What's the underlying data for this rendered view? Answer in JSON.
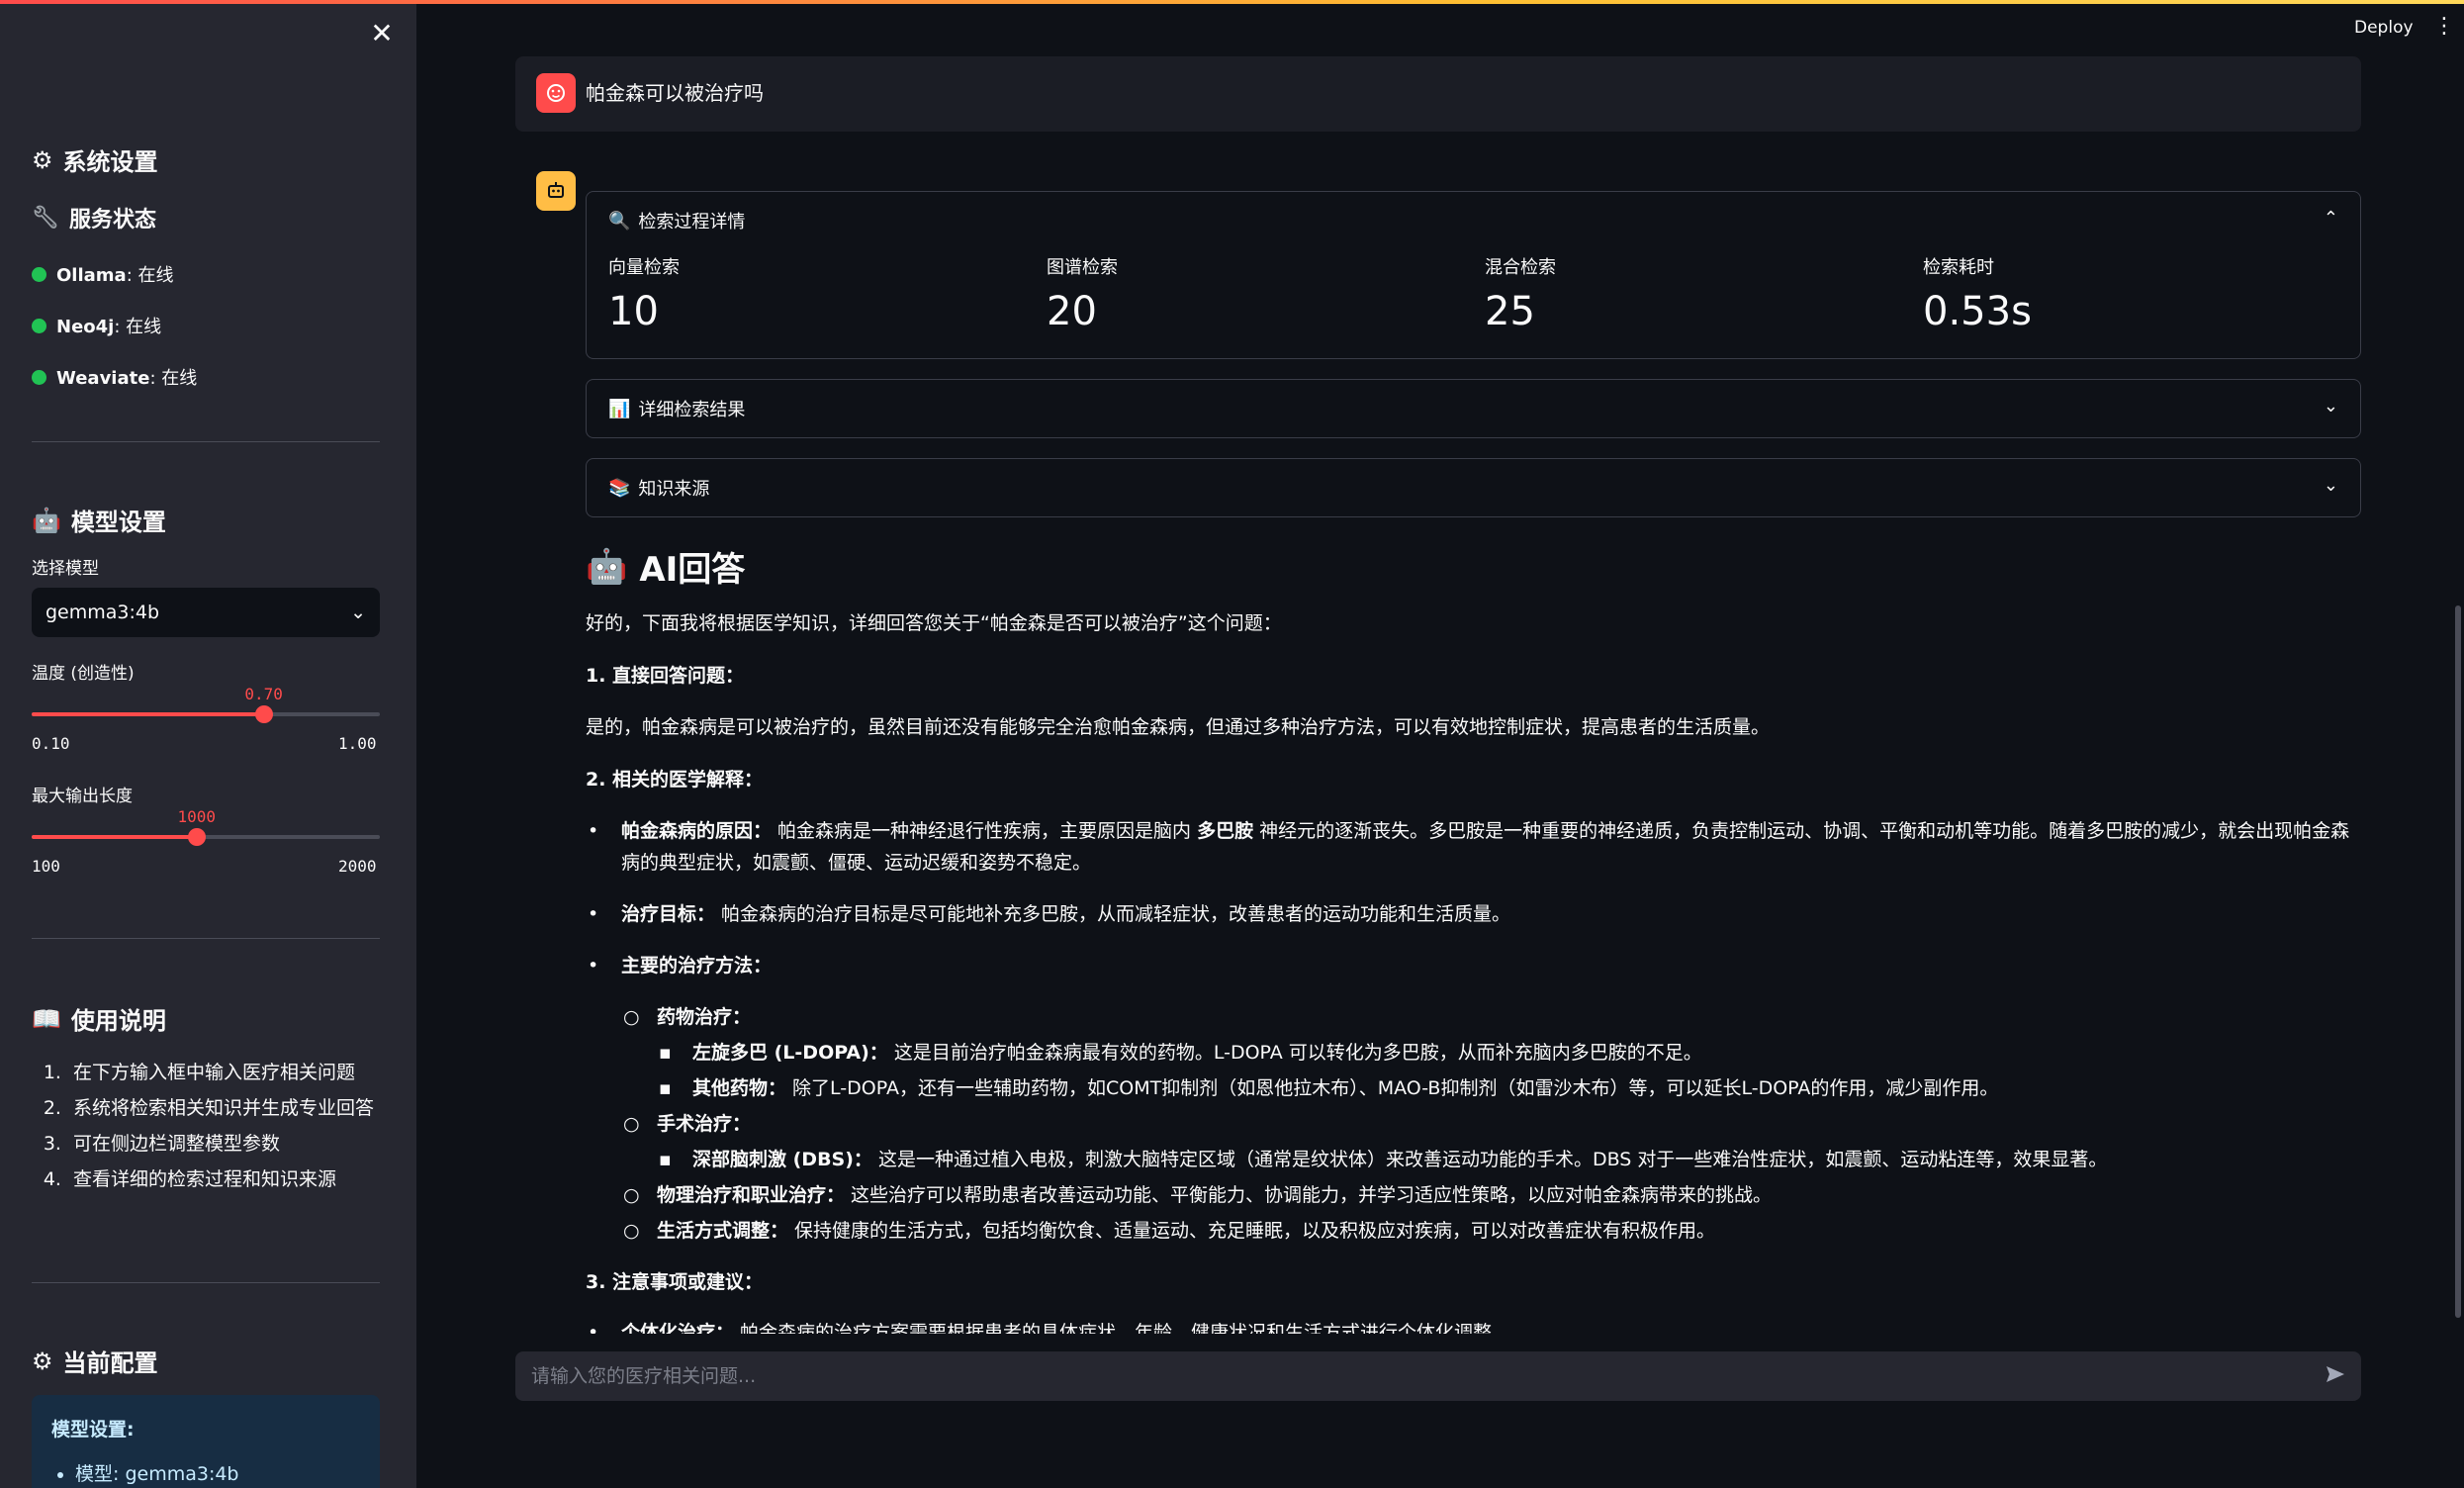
{
  "header": {
    "deploy_label": "Deploy",
    "menu_icon": "kebab-menu-icon"
  },
  "sidebar": {
    "close_icon": "close-icon",
    "system_settings_title": "系统设置",
    "service_status_title": "服务状态",
    "services": [
      {
        "name": "Ollama",
        "status": ": 在线"
      },
      {
        "name": "Neo4j",
        "status": ": 在线"
      },
      {
        "name": "Weaviate",
        "status": ": 在线"
      }
    ],
    "model_settings_title": "模型设置",
    "select_model_label": "选择模型",
    "selected_model": "gemma3:4b",
    "temperature": {
      "label": "温度 (创造性)",
      "value": 0.7,
      "value_text": "0.70",
      "min": "0.10",
      "max": "1.00",
      "min_num": 0.1,
      "max_num": 1.0
    },
    "max_length": {
      "label": "最大输出长度",
      "value": 1000,
      "value_text": "1000",
      "min": "100",
      "max": "2000",
      "min_num": 100,
      "max_num": 2000
    },
    "usage_title": "使用说明",
    "usage_items": [
      "在下方输入框中输入医疗相关问题",
      "系统将检索相关知识并生成专业回答",
      "可在侧边栏调整模型参数",
      "查看详细的检索过程和知识来源"
    ],
    "current_config_title": "当前配置",
    "config_box": {
      "title": "模型设置:",
      "items": [
        "模型: gemma3:4b"
      ]
    }
  },
  "chat": {
    "user_message": "帕金森可以被治疗吗",
    "retrieval_expander": {
      "title": "检索过程详情",
      "metrics": [
        {
          "label": "向量检索",
          "value": "10"
        },
        {
          "label": "图谱检索",
          "value": "20"
        },
        {
          "label": "混合检索",
          "value": "25"
        },
        {
          "label": "检索耗时",
          "value": "0.53s"
        }
      ]
    },
    "detail_expander_title": "详细检索结果",
    "source_expander_title": "知识来源",
    "answer_title": "AI回答",
    "answer": {
      "intro": "好的，下面我将根据医学知识，详细回答您关于“帕金森是否可以被治疗”这个问题：",
      "s1_title": "1. 直接回答问题：",
      "s1_text": "是的，帕金森病是可以被治疗的，虽然目前还没有能够完全治愈帕金森病，但通过多种治疗方法，可以有效地控制症状，提高患者的生活质量。",
      "s2_title": "2. 相关的医学解释：",
      "b1_label": "帕金森病的原因：",
      "b1_text_a": " 帕金森病是一种神经退行性疾病，主要原因是脑内 ",
      "b1_bold": "多巴胺",
      "b1_text_b": " 神经元的逐渐丧失。多巴胺是一种重要的神经递质，负责控制运动、协调、平衡和动机等功能。随着多巴胺的减少，就会出现帕金森病的典型症状，如震颤、僵硬、运动迟缓和姿势不稳定。",
      "b2_label": "治疗目标：",
      "b2_text": " 帕金森病的治疗目标是尽可能地补充多巴胺，从而减轻症状，改善患者的运动功能和生活质量。",
      "b3_label": "主要的治疗方法：",
      "drug_label": "药物治疗：",
      "drug1_label": "左旋多巴 (L-DOPA)：",
      "drug1_text": " 这是目前治疗帕金森病最有效的药物。L-DOPA 可以转化为多巴胺，从而补充脑内多巴胺的不足。",
      "drug2_label": "其他药物：",
      "drug2_text": " 除了L-DOPA，还有一些辅助药物，如COMT抑制剂（如恩他拉木布）、MAO-B抑制剂（如雷沙木布）等，可以延长L-DOPA的作用，减少副作用。",
      "surgery_label": "手术治疗：",
      "surgery1_label": "深部脑刺激 (DBS)：",
      "surgery1_text": " 这是一种通过植入电极，刺激大脑特定区域（通常是纹状体）来改善运动功能的手术。DBS 对于一些难治性症状，如震颤、运动粘连等，效果显著。",
      "physio_label": "物理治疗和职业治疗：",
      "physio_text": " 这些治疗可以帮助患者改善运动功能、平衡能力、协调能力，并学习适应性策略，以应对帕金森病带来的挑战。",
      "life_label": "生活方式调整：",
      "life_text": " 保持健康的生活方式，包括均衡饮食、适量运动、充足睡眠，以及积极应对疾病，可以对改善症状有积极作用。",
      "s3_title": "3. 注意事项或建议：",
      "s3_b1_label": "个体化治疗：",
      "s3_b1_text": " 帕金森病的治疗方案需要根据患者的具体症状、年龄、健康状况和生活方式进行个体化调整。"
    },
    "input_placeholder": "请输入您的医疗相关问题..."
  }
}
